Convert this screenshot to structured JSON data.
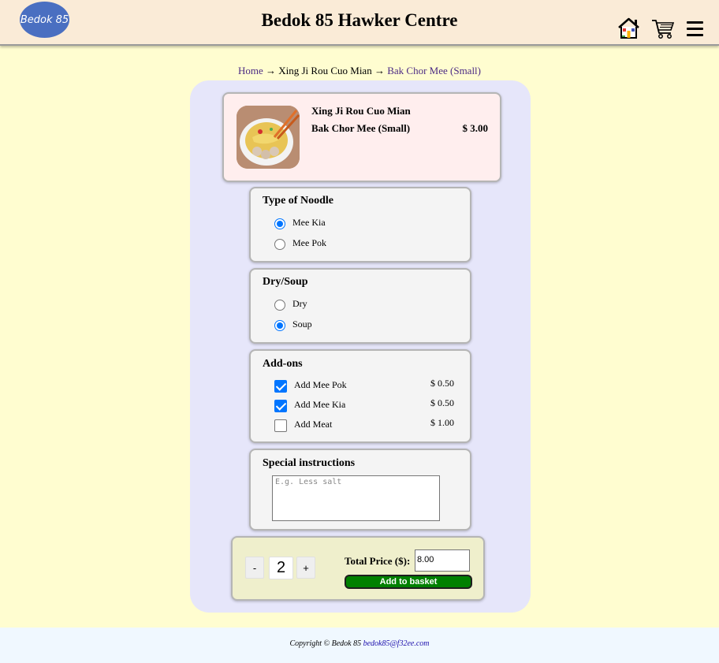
{
  "header": {
    "logo_text": "Bedok 85",
    "title": "Bedok 85 Hawker Centre",
    "icons": [
      "home-icon",
      "cart-icon",
      "menu-icon"
    ]
  },
  "breadcrumb": {
    "home": "Home",
    "sep1": "→",
    "stall": "Xing Ji Rou Cuo Mian",
    "sep2": "→",
    "item": "Bak Chor Mee (Small)"
  },
  "item": {
    "stall_name": "Xing Ji Rou Cuo Mian",
    "dish_name": "Bak Chor Mee (Small)",
    "price": "$ 3.00"
  },
  "noodle": {
    "title": "Type of Noodle",
    "options": [
      {
        "label": "Mee Kia",
        "checked": true
      },
      {
        "label": "Mee Pok",
        "checked": false
      }
    ]
  },
  "drysoup": {
    "title": "Dry/Soup",
    "options": [
      {
        "label": "Dry",
        "checked": false
      },
      {
        "label": "Soup",
        "checked": true
      }
    ]
  },
  "addons": {
    "title": "Add-ons",
    "items": [
      {
        "label": "Add Mee Pok",
        "price": "$ 0.50",
        "checked": true
      },
      {
        "label": "Add Mee Kia",
        "price": "$ 0.50",
        "checked": true
      },
      {
        "label": "Add Meat",
        "price": "$ 1.00",
        "checked": false
      }
    ]
  },
  "instructions": {
    "title": "Special instructions",
    "placeholder": "E.g. Less salt"
  },
  "order": {
    "minus": "-",
    "quantity": "2",
    "plus": "+",
    "total_label": "Total Price ($):",
    "total_value": "8.00",
    "add_button": "Add to basket"
  },
  "footer": {
    "copyright": "Copyright © Bedok 85",
    "email": "bedok85@f32ee.com"
  },
  "colors": {
    "page_bg": "#fffdd0",
    "header_bg": "#faebd7",
    "panel_bg": "#e6e6fa",
    "item_card_bg": "#ffeeee",
    "option_card_bg": "#f4f4f4",
    "total_card_bg": "#efefcc",
    "button_green": "#008000",
    "accent_blue": "#0075ff",
    "footer_bg": "#f0f8ff"
  }
}
